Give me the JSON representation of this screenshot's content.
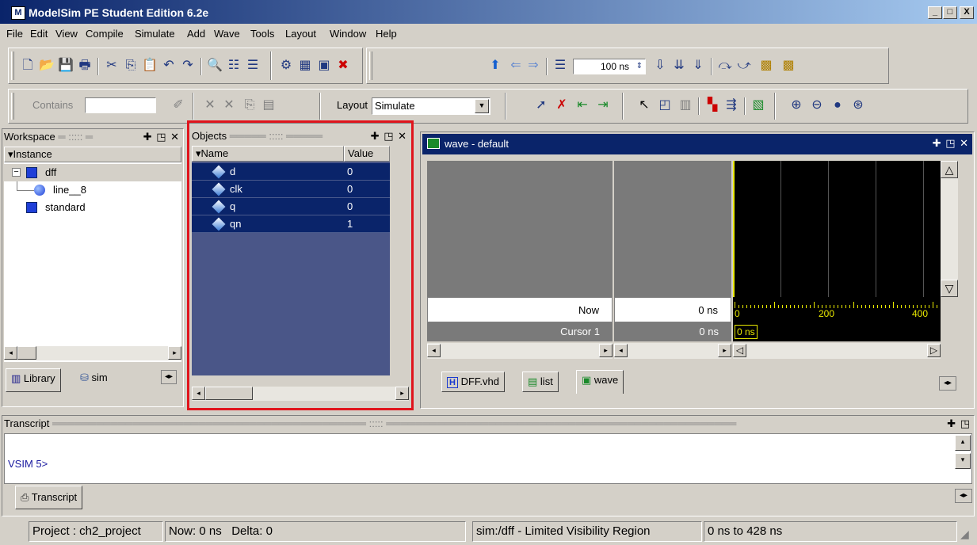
{
  "window": {
    "title": "ModelSim PE Student Edition 6.2e",
    "min_label": "_",
    "max_label": "□",
    "close_label": "X"
  },
  "menu": [
    "File",
    "Edit",
    "View",
    "Compile",
    "Simulate",
    "Add",
    "Wave",
    "Tools",
    "Layout",
    "Window",
    "Help"
  ],
  "toolbar": {
    "run_length": "100 ns",
    "contains_label": "Contains",
    "contains_value": "",
    "layout_label": "Layout",
    "layout_value": "Simulate"
  },
  "workspace": {
    "title": "Workspace",
    "column": "Instance",
    "items": [
      {
        "label": "dff",
        "level": 0
      },
      {
        "label": "line__8",
        "level": 1
      },
      {
        "label": "standard",
        "level": 0
      }
    ],
    "tabs": [
      "Library",
      "sim"
    ]
  },
  "objects": {
    "title": "Objects",
    "columns": [
      "Name",
      "Value"
    ],
    "rows": [
      {
        "name": "d",
        "value": "0"
      },
      {
        "name": "clk",
        "value": "0"
      },
      {
        "name": "q",
        "value": "0"
      },
      {
        "name": "qn",
        "value": "1"
      }
    ],
    "highlight_color": "#e0141c"
  },
  "wave": {
    "title": "wave - default",
    "now_label": "Now",
    "now_value": "0 ns",
    "cursor_label": "Cursor 1",
    "cursor_value": "0 ns",
    "cursor_box": "0 ns",
    "ruler_labels": [
      "0",
      "200",
      "400"
    ],
    "ruler_color": "#e8e800",
    "tabs": [
      "DFF.vhd",
      "list",
      "wave"
    ]
  },
  "transcript": {
    "title": "Transcript",
    "prompt": "VSIM 5>",
    "tab": "Transcript"
  },
  "status": {
    "project": "Project : ch2_project",
    "now": "Now: 0 ns",
    "delta": "Delta: 0",
    "region": "sim:/dff - Limited Visibility Region",
    "range": "0 ns to 428 ns"
  }
}
